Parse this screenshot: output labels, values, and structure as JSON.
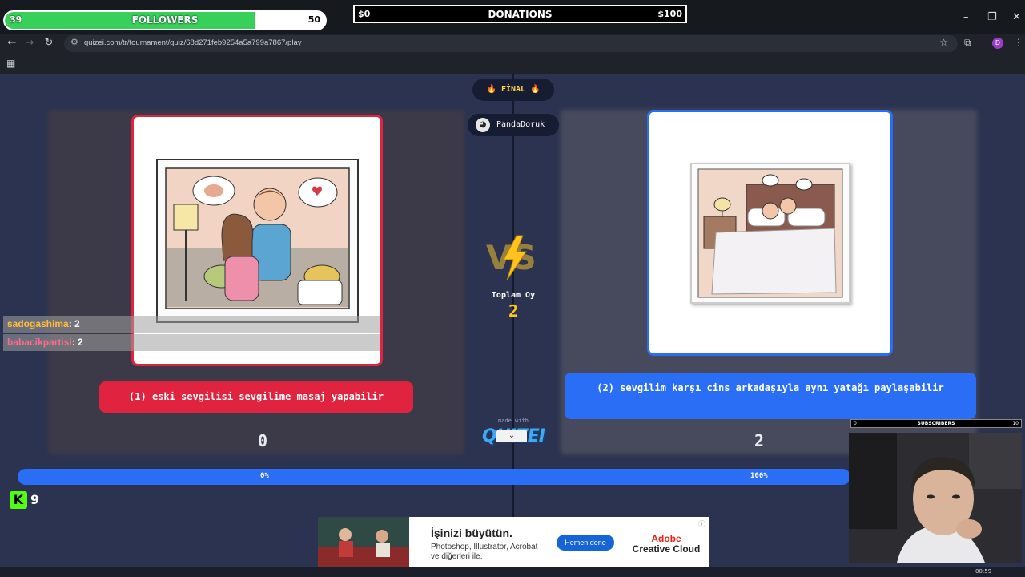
{
  "overlay": {
    "followers": {
      "label": "FOLLOWERS",
      "current": "39",
      "goal": "50",
      "progress": 0.78
    },
    "donations": {
      "label": "DONATIONS",
      "current": "$0",
      "goal": "$100"
    },
    "subscribers": {
      "label": "SUBSCRIBERS",
      "current": "0",
      "goal": "10"
    },
    "kick": {
      "letter": "K",
      "viewers": "9"
    },
    "chat": [
      {
        "user": "sadogashima",
        "msg": ": 2"
      },
      {
        "user": "babacikpartisi",
        "msg": ": 2"
      }
    ]
  },
  "browser": {
    "url": "quizei.com/tr/tournament/quiz/68d271feb9254a5a799a7867/play",
    "window_controls": [
      "–",
      "❐",
      "✕"
    ],
    "profile_initial": "D"
  },
  "quiz": {
    "round_badge": "🔥 FİNAL 🔥",
    "creator": "PandaDoruk",
    "total_label": "Toplam Oy",
    "total_votes": "2",
    "options": [
      {
        "label": "(1) eski sevgilisi sevgilime masaj yapabilir",
        "votes": "0",
        "percent": "0%",
        "share": 0
      },
      {
        "label": "(2) sevgilim karşı cins arkadaşıyla aynı yatağı paylaşabilir",
        "votes": "2",
        "percent": "100%",
        "share": 1
      }
    ],
    "made_with": "made with",
    "logo": "QUIZEI",
    "colors": {
      "left": "#e0243f",
      "right": "#2a6ef5",
      "accent": "#ffc21e"
    }
  },
  "ad": {
    "title": "İşinizi büyütün.",
    "desc": "Photoshop, Illustrator, Acrobat ve diğerleri ile.",
    "cta": "Hemen dene",
    "brand1": "Adobe",
    "brand2": "Creative Cloud"
  },
  "taskbar": {
    "clock": "00:59"
  }
}
